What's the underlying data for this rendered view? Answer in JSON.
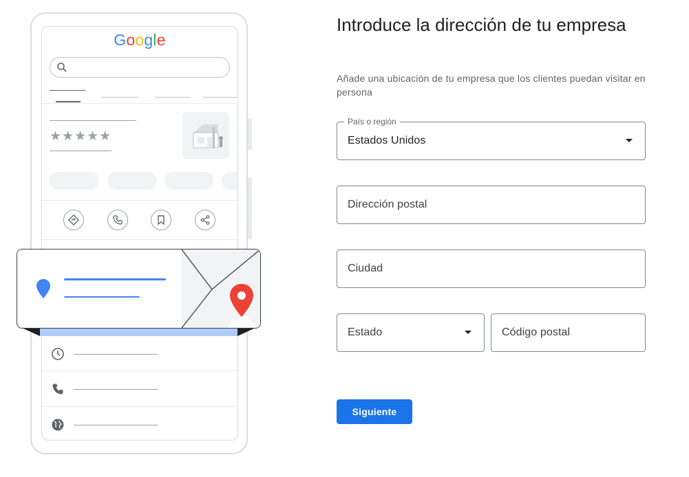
{
  "illustration": {
    "logo_letters": [
      {
        "char": "G",
        "color": "#4285F4"
      },
      {
        "char": "o",
        "color": "#EA4335"
      },
      {
        "char": "o",
        "color": "#FBBC05"
      },
      {
        "char": "g",
        "color": "#4285F4"
      },
      {
        "char": "l",
        "color": "#34A853"
      },
      {
        "char": "e",
        "color": "#EA4335"
      }
    ],
    "stars": "★★★★★",
    "action_icons": [
      "directions-icon",
      "phone-icon",
      "bookmark-icon",
      "share-icon"
    ],
    "info_icons": [
      "clock-icon",
      "phone-icon",
      "globe-icon"
    ],
    "pin_colors": {
      "blue": "#4285F4",
      "red": "#EA4335"
    }
  },
  "form": {
    "title": "Introduce la dirección de tu empresa",
    "subtitle": "Añade una ubicación de tu empresa que los clientes puedan visitar en persona",
    "country": {
      "label": "País o región",
      "value": "Estados Unidos"
    },
    "street": {
      "placeholder": "Dirección postal"
    },
    "city": {
      "placeholder": "Ciudad"
    },
    "state": {
      "placeholder": "Estado"
    },
    "zip": {
      "placeholder": "Código postal"
    },
    "next_label": "Siguiente"
  },
  "colors": {
    "accent": "#1a73e8",
    "border": "#80868b"
  }
}
